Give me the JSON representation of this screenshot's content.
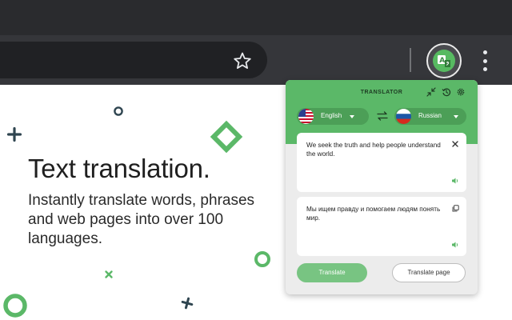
{
  "browser": {
    "toolbar_icons": [
      "star-icon",
      "extension-translator-icon",
      "more-vert-icon"
    ]
  },
  "hero": {
    "title": "Text translation.",
    "description": "Instantly translate words, phrases and web pages into over 100 languages."
  },
  "popup": {
    "title": "TRANSLATOR",
    "header_icons": [
      "collapse-icon",
      "history-icon",
      "settings-icon"
    ],
    "source_lang": {
      "label": "English",
      "flag": "us-flag-icon"
    },
    "target_lang": {
      "label": "Russian",
      "flag": "ru-flag-icon"
    },
    "source_text": "We seek the truth and help people understand the world.",
    "result_text": "Мы ищем правду и помогаем людям понять мир.",
    "translate_button": "Translate",
    "translate_page_button": "Translate page"
  },
  "colors": {
    "accent": "#5bb868",
    "accent_dark": "#4c9f57",
    "translate_button": "#78c482",
    "toolbar": "#35363a",
    "topbar": "#2a2b2e"
  }
}
